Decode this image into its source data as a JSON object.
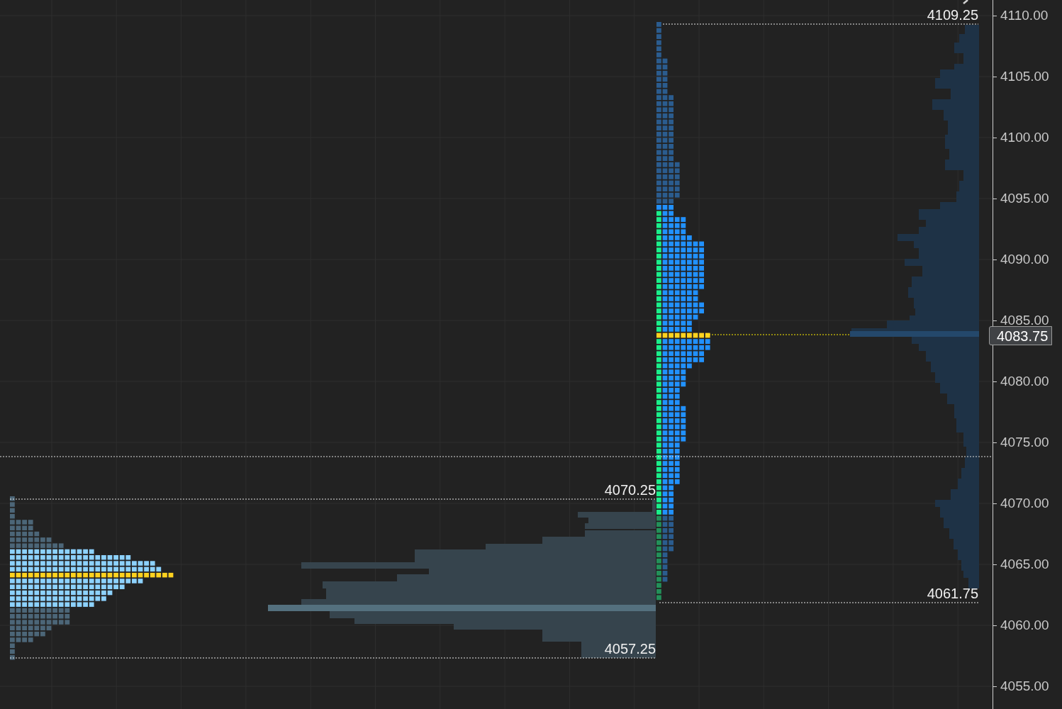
{
  "price_axis": {
    "labels": [
      "4110.00",
      "4105.00",
      "4100.00",
      "4095.00",
      "4090.00",
      "4085.00",
      "4080.00",
      "4075.00",
      "4070.00",
      "4065.00",
      "4060.00",
      "4055.00"
    ]
  },
  "levels": [
    {
      "kind": "high",
      "label": "4109.25"
    },
    {
      "kind": "prev-high",
      "label": "4070.25"
    },
    {
      "kind": "low",
      "label": "4061.75"
    },
    {
      "kind": "prev-low",
      "label": "4057.25"
    }
  ],
  "current_price": {
    "label": "4083.75"
  }
}
